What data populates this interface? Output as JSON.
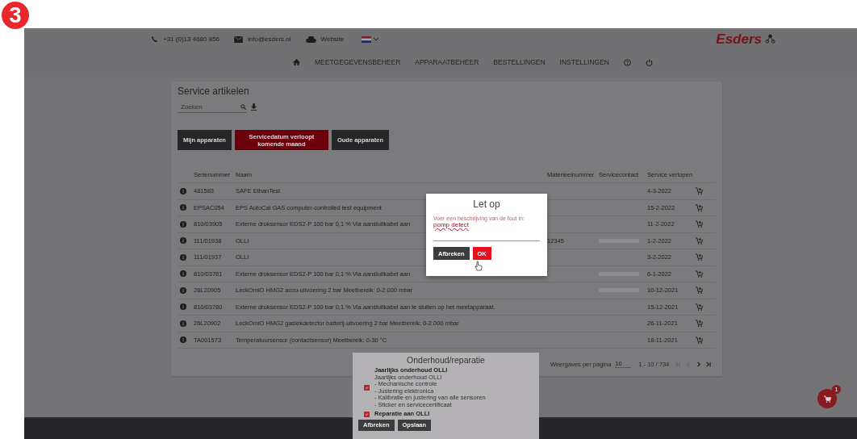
{
  "step_badge": "3",
  "topbar": {
    "phone": "+31 (0)13 4680 856",
    "email": "info@esders.nl",
    "website": "Website",
    "logo": "Esders"
  },
  "nav": [
    {
      "label": "MEETGEGEVENSBEHEER"
    },
    {
      "label": "APPARAATBEHEER"
    },
    {
      "label": "BESTELLINGEN"
    },
    {
      "label": "INSTELLINGEN"
    }
  ],
  "card": {
    "title": "Service artikelen",
    "search": {
      "placeholder": "Zoeken"
    },
    "filters": [
      {
        "label": "Mijn apparaten",
        "selected": false
      },
      {
        "label": "Servicedatum verloopt komende maand",
        "selected": true
      },
      {
        "label": "Oude apparaten",
        "selected": false
      }
    ],
    "table": {
      "columns": [
        "Serienummer",
        "Naam",
        "Materieelnummer",
        "Servicecontact",
        "Service verlopen"
      ],
      "rows": [
        {
          "serial": "481583",
          "name": "SAFE EthanTest",
          "material": "",
          "contact_blurred": false,
          "expires": "4-3-2022"
        },
        {
          "serial": "EPSAC054",
          "name": "EPS AutoCal GAS computer-controlled test equipment",
          "material": "",
          "contact_blurred": false,
          "expires": "15-2-2022"
        },
        {
          "serial": "810/03905",
          "name": "Externe druksensor EDS2-P 100 bar 0,1 % Via aansluitkabel aan",
          "material": "",
          "contact_blurred": false,
          "expires": "11-2-2022"
        },
        {
          "serial": "111/01938",
          "name": "OLLI",
          "material": "12345",
          "contact_blurred": true,
          "expires": "1-2-2022"
        },
        {
          "serial": "111/01937",
          "name": "OLLI",
          "material": "",
          "contact_blurred": false,
          "expires": "3-2-2022"
        },
        {
          "serial": "810/03781",
          "name": "Externe druksensor EDS2-P 100 bar 0,1 % Via aansluitkabel aan",
          "material": "",
          "contact_blurred": true,
          "expires": "6-1-2022"
        },
        {
          "serial": "26L20905",
          "name": "LeckOmiO HMG2 accu-uitvoering 2 bar Meetbereik: 0-2.000 mbar",
          "material": "",
          "contact_blurred": true,
          "expires": "10-12-2021"
        },
        {
          "serial": "810/03780",
          "name": "Externe druksensor EDS2-P 100 bar 0,1 % Via aansluitkabel aan te sluiten op het meetapparaat.",
          "material": "",
          "contact_blurred": false,
          "expires": "15-12-2021"
        },
        {
          "serial": "26L20902",
          "name": "LeckOmiO HMG2 gaslekdetector batterij-uitvoering 2 bar Meetbereik: 0-2.000 mbar",
          "material": "",
          "contact_blurred": false,
          "expires": "26-11-2021"
        },
        {
          "serial": "TA001573",
          "name": "Temperatuursensor (contactsensor) Meetbereik: 0-30 °C",
          "material": "",
          "contact_blurred": false,
          "expires": "18-11-2021"
        }
      ]
    },
    "pagination": {
      "per_page_label": "Weergaves per pagina",
      "per_page": "10",
      "range": "1 - 10 / 734"
    }
  },
  "cart_count": "1",
  "dialog": {
    "title": "Let op",
    "field_label": "Voer een beschrijving van de fout in:",
    "field_value": "pomp defect",
    "buttons": [
      "Afbreken",
      "OK"
    ]
  },
  "service_panel": {
    "title": "Onderhoud/reparatie",
    "options": [
      {
        "title": "Jaarlijks onderhoud OLLI",
        "lines": [
          "Jaarlijks onderhoud OLLI",
          "- Mechanische controle",
          "- Justering elektronica",
          "- Kalibratie en justering van alle sensoren",
          "- Sticker en servicecertificaat"
        ],
        "checked": true
      },
      {
        "title": "Reparatie aan OLLI",
        "checked": true
      }
    ],
    "buttons": [
      "Afbreken",
      "Opslaan"
    ]
  }
}
